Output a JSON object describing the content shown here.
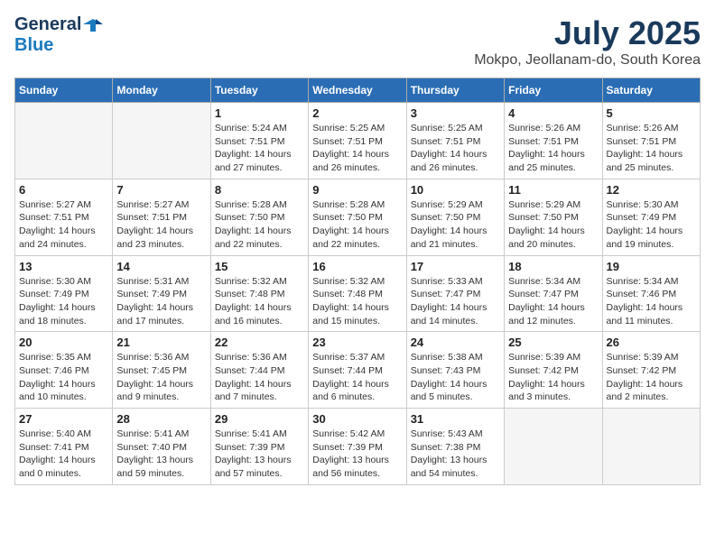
{
  "logo": {
    "general": "General",
    "blue": "Blue"
  },
  "title": "July 2025",
  "location": "Mokpo, Jeollanam-do, South Korea",
  "weekdays": [
    "Sunday",
    "Monday",
    "Tuesday",
    "Wednesday",
    "Thursday",
    "Friday",
    "Saturday"
  ],
  "weeks": [
    [
      {
        "day": "",
        "detail": ""
      },
      {
        "day": "",
        "detail": ""
      },
      {
        "day": "1",
        "detail": "Sunrise: 5:24 AM\nSunset: 7:51 PM\nDaylight: 14 hours and 27 minutes."
      },
      {
        "day": "2",
        "detail": "Sunrise: 5:25 AM\nSunset: 7:51 PM\nDaylight: 14 hours and 26 minutes."
      },
      {
        "day": "3",
        "detail": "Sunrise: 5:25 AM\nSunset: 7:51 PM\nDaylight: 14 hours and 26 minutes."
      },
      {
        "day": "4",
        "detail": "Sunrise: 5:26 AM\nSunset: 7:51 PM\nDaylight: 14 hours and 25 minutes."
      },
      {
        "day": "5",
        "detail": "Sunrise: 5:26 AM\nSunset: 7:51 PM\nDaylight: 14 hours and 25 minutes."
      }
    ],
    [
      {
        "day": "6",
        "detail": "Sunrise: 5:27 AM\nSunset: 7:51 PM\nDaylight: 14 hours and 24 minutes."
      },
      {
        "day": "7",
        "detail": "Sunrise: 5:27 AM\nSunset: 7:51 PM\nDaylight: 14 hours and 23 minutes."
      },
      {
        "day": "8",
        "detail": "Sunrise: 5:28 AM\nSunset: 7:50 PM\nDaylight: 14 hours and 22 minutes."
      },
      {
        "day": "9",
        "detail": "Sunrise: 5:28 AM\nSunset: 7:50 PM\nDaylight: 14 hours and 22 minutes."
      },
      {
        "day": "10",
        "detail": "Sunrise: 5:29 AM\nSunset: 7:50 PM\nDaylight: 14 hours and 21 minutes."
      },
      {
        "day": "11",
        "detail": "Sunrise: 5:29 AM\nSunset: 7:50 PM\nDaylight: 14 hours and 20 minutes."
      },
      {
        "day": "12",
        "detail": "Sunrise: 5:30 AM\nSunset: 7:49 PM\nDaylight: 14 hours and 19 minutes."
      }
    ],
    [
      {
        "day": "13",
        "detail": "Sunrise: 5:30 AM\nSunset: 7:49 PM\nDaylight: 14 hours and 18 minutes."
      },
      {
        "day": "14",
        "detail": "Sunrise: 5:31 AM\nSunset: 7:49 PM\nDaylight: 14 hours and 17 minutes."
      },
      {
        "day": "15",
        "detail": "Sunrise: 5:32 AM\nSunset: 7:48 PM\nDaylight: 14 hours and 16 minutes."
      },
      {
        "day": "16",
        "detail": "Sunrise: 5:32 AM\nSunset: 7:48 PM\nDaylight: 14 hours and 15 minutes."
      },
      {
        "day": "17",
        "detail": "Sunrise: 5:33 AM\nSunset: 7:47 PM\nDaylight: 14 hours and 14 minutes."
      },
      {
        "day": "18",
        "detail": "Sunrise: 5:34 AM\nSunset: 7:47 PM\nDaylight: 14 hours and 12 minutes."
      },
      {
        "day": "19",
        "detail": "Sunrise: 5:34 AM\nSunset: 7:46 PM\nDaylight: 14 hours and 11 minutes."
      }
    ],
    [
      {
        "day": "20",
        "detail": "Sunrise: 5:35 AM\nSunset: 7:46 PM\nDaylight: 14 hours and 10 minutes."
      },
      {
        "day": "21",
        "detail": "Sunrise: 5:36 AM\nSunset: 7:45 PM\nDaylight: 14 hours and 9 minutes."
      },
      {
        "day": "22",
        "detail": "Sunrise: 5:36 AM\nSunset: 7:44 PM\nDaylight: 14 hours and 7 minutes."
      },
      {
        "day": "23",
        "detail": "Sunrise: 5:37 AM\nSunset: 7:44 PM\nDaylight: 14 hours and 6 minutes."
      },
      {
        "day": "24",
        "detail": "Sunrise: 5:38 AM\nSunset: 7:43 PM\nDaylight: 14 hours and 5 minutes."
      },
      {
        "day": "25",
        "detail": "Sunrise: 5:39 AM\nSunset: 7:42 PM\nDaylight: 14 hours and 3 minutes."
      },
      {
        "day": "26",
        "detail": "Sunrise: 5:39 AM\nSunset: 7:42 PM\nDaylight: 14 hours and 2 minutes."
      }
    ],
    [
      {
        "day": "27",
        "detail": "Sunrise: 5:40 AM\nSunset: 7:41 PM\nDaylight: 14 hours and 0 minutes."
      },
      {
        "day": "28",
        "detail": "Sunrise: 5:41 AM\nSunset: 7:40 PM\nDaylight: 13 hours and 59 minutes."
      },
      {
        "day": "29",
        "detail": "Sunrise: 5:41 AM\nSunset: 7:39 PM\nDaylight: 13 hours and 57 minutes."
      },
      {
        "day": "30",
        "detail": "Sunrise: 5:42 AM\nSunset: 7:39 PM\nDaylight: 13 hours and 56 minutes."
      },
      {
        "day": "31",
        "detail": "Sunrise: 5:43 AM\nSunset: 7:38 PM\nDaylight: 13 hours and 54 minutes."
      },
      {
        "day": "",
        "detail": ""
      },
      {
        "day": "",
        "detail": ""
      }
    ]
  ]
}
